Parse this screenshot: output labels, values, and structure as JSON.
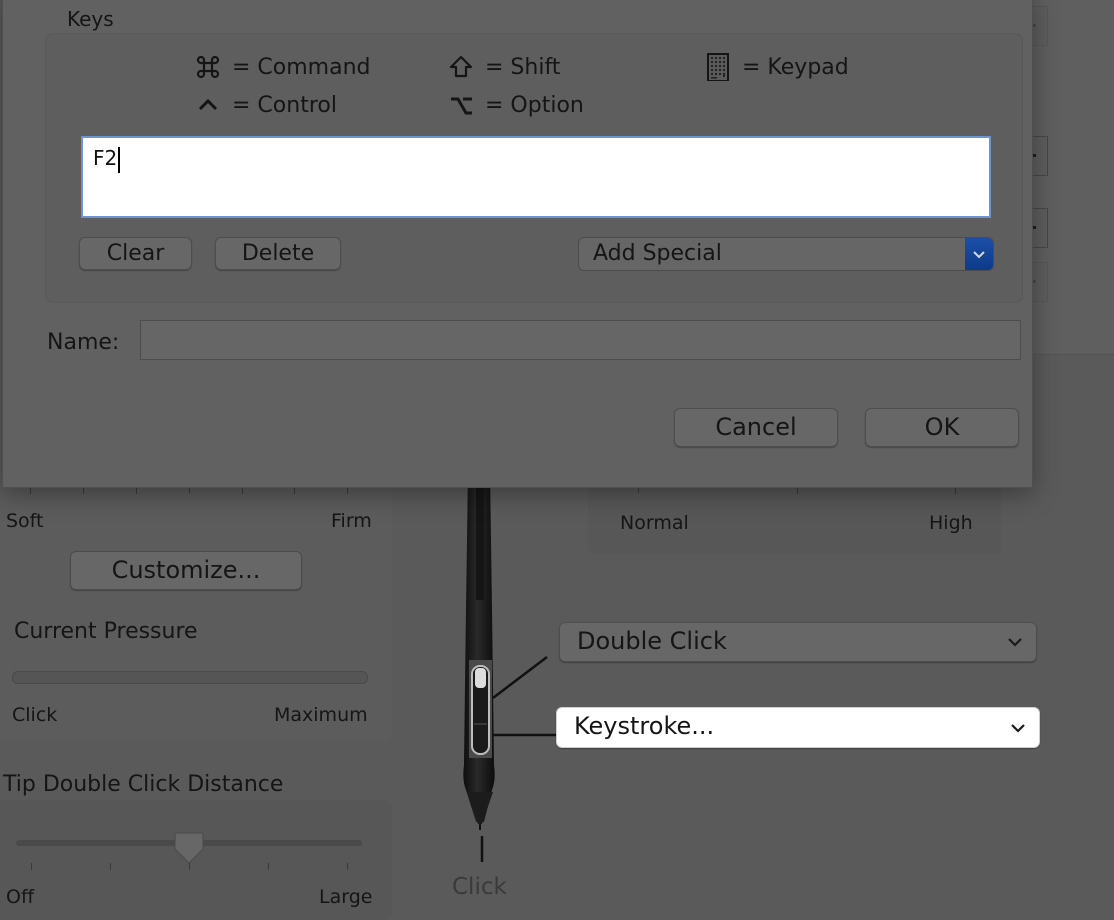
{
  "dialog": {
    "section_title": "Keys",
    "legend": [
      {
        "icon": "command-icon",
        "symbol": "⌘",
        "label": "= Command"
      },
      {
        "icon": "shift-icon",
        "symbol": "⇧",
        "label": "= Shift"
      },
      {
        "icon": "keypad-icon",
        "symbol": "▦",
        "label": "= Keypad"
      },
      {
        "icon": "control-icon",
        "symbol": "^",
        "label": "= Control"
      },
      {
        "icon": "option-icon",
        "symbol": "⌥",
        "label": "= Option"
      }
    ],
    "keystroke_value": "F2",
    "clear_label": "Clear",
    "delete_label": "Delete",
    "add_special_label": "Add Special",
    "name_label": "Name:",
    "name_value": "",
    "cancel_label": "Cancel",
    "ok_label": "OK"
  },
  "background": {
    "tip_feel": {
      "min_label": "Soft",
      "max_label": "Firm",
      "customize_label": "Customize...",
      "current_pressure_label": "Current Pressure",
      "pressure_min_label": "Click",
      "pressure_max_label": "Maximum",
      "current_pressure_fraction": 0
    },
    "tilt_sensitivity": {
      "min_label": "Normal",
      "max_label": "High",
      "value_fraction": 0
    },
    "double_click_distance": {
      "title": "Tip Double Click Distance",
      "min_label": "Off",
      "max_label": "Large",
      "value_fraction": 0.5
    },
    "pen": {
      "upper_button_action": "Double Click",
      "lower_button_action": "Keystroke...",
      "tip_label": "Click"
    }
  }
}
